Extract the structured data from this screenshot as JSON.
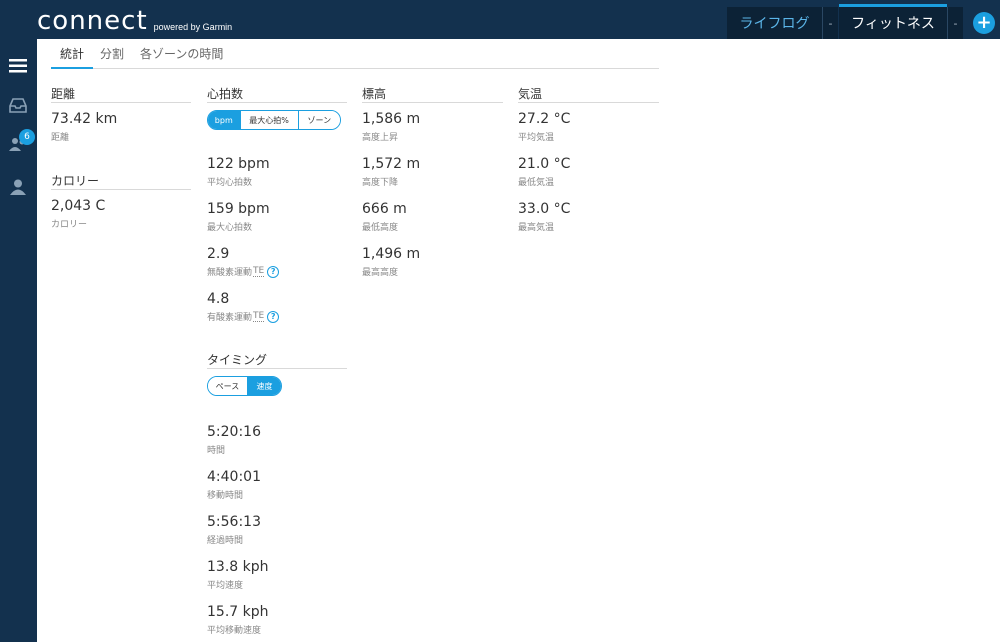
{
  "header": {
    "logo_word": "connect",
    "logo_sub": "powered by Garmin",
    "tabs": [
      {
        "label": "ライフログ",
        "caret": "-"
      },
      {
        "label": "フィットネス",
        "caret": "-"
      }
    ],
    "add_label": "+"
  },
  "sidebar": {
    "badge_count": "6",
    "icons": [
      "menu-icon",
      "inbox-icon",
      "connections-icon",
      "profile-icon"
    ]
  },
  "subtabs": [
    "統計",
    "分割",
    "各ゾーンの時間"
  ],
  "distance": {
    "title": "距離",
    "stats": [
      {
        "value": "73.42 km",
        "label": "距離"
      }
    ]
  },
  "calories": {
    "title": "カロリー",
    "stats": [
      {
        "value": "2,043 C",
        "label": "カロリー"
      }
    ]
  },
  "heart_rate": {
    "title": "心拍数",
    "toggle": [
      "bpm",
      "最大心拍%",
      "ゾーン"
    ],
    "stats": [
      {
        "value": "122 bpm",
        "label": "平均心拍数"
      },
      {
        "value": "159 bpm",
        "label": "最大心拍数"
      },
      {
        "value": "2.9",
        "label": "無酸素運動",
        "suffix": "TE"
      },
      {
        "value": "4.8",
        "label": "有酸素運動",
        "suffix": "TE"
      }
    ],
    "help": "?"
  },
  "timing": {
    "title": "タイミング",
    "toggle": [
      "ペース",
      "速度"
    ],
    "stats": [
      {
        "value": "5:20:16",
        "label": "時間"
      },
      {
        "value": "4:40:01",
        "label": "移動時間"
      },
      {
        "value": "5:56:13",
        "label": "経過時間"
      },
      {
        "value": "13.8 kph",
        "label": "平均速度"
      },
      {
        "value": "15.7 kph",
        "label": "平均移動速度"
      }
    ]
  },
  "elevation": {
    "title": "標高",
    "stats": [
      {
        "value": "1,586 m",
        "label": "高度上昇"
      },
      {
        "value": "1,572 m",
        "label": "高度下降"
      },
      {
        "value": "666 m",
        "label": "最低高度"
      },
      {
        "value": "1,496 m",
        "label": "最高高度"
      }
    ]
  },
  "temperature": {
    "title": "気温",
    "stats": [
      {
        "value": "27.2 °C",
        "label": "平均気温"
      },
      {
        "value": "21.0 °C",
        "label": "最低気温"
      },
      {
        "value": "33.0 °C",
        "label": "最高気温"
      }
    ]
  },
  "colors": {
    "accent": "#1b9fe0",
    "nav": "#13314e"
  }
}
